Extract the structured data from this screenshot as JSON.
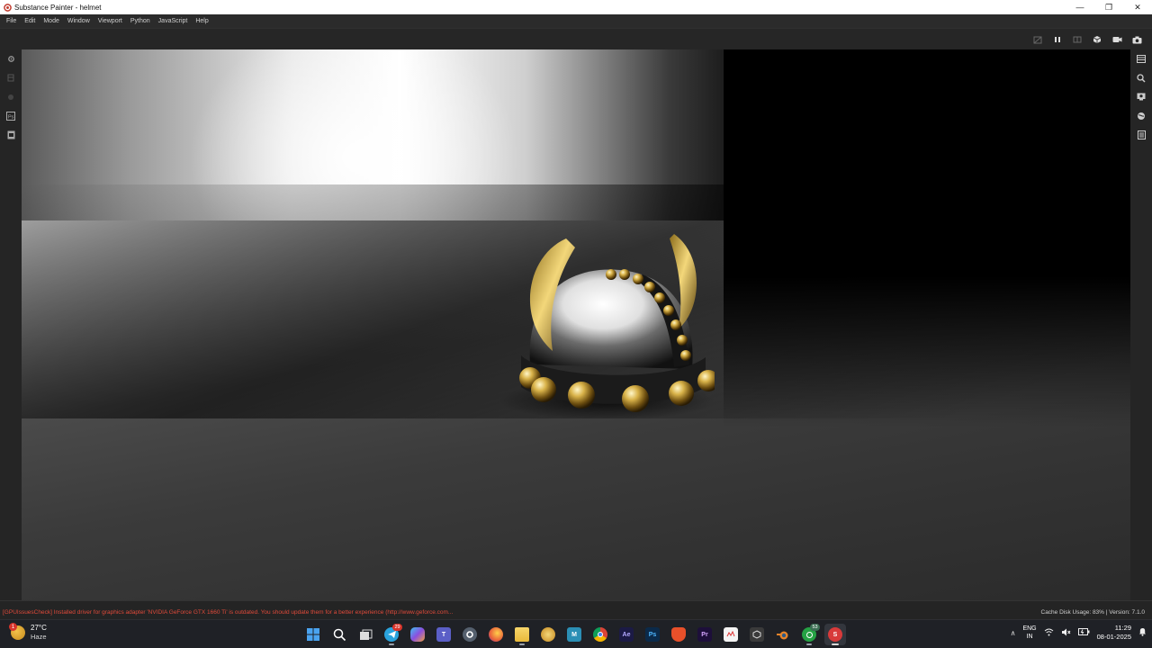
{
  "window": {
    "title": "Substance Painter - helmet",
    "controls": [
      "minimize-icon",
      "restore-icon",
      "close-icon"
    ]
  },
  "menu": [
    "File",
    "Edit",
    "Mode",
    "Window",
    "Viewport",
    "Python",
    "JavaScript",
    "Help"
  ],
  "toolbar": {
    "right_icons": [
      "camera-off-icon",
      "pause-icon",
      "split-view-icon",
      "cube-view-icon",
      "camera-icon",
      "screenshot-icon"
    ]
  },
  "left_tools": [
    "settings-icon",
    "layers-icon",
    "bake-icon",
    "photoshop-export-icon",
    "export-textures-icon"
  ],
  "right_tools": [
    "layers-panel-icon",
    "zoom-icon",
    "display-settings-icon",
    "environment-icon",
    "shader-settings-icon"
  ],
  "status": {
    "warning": "[GPUIssuesCheck] Installed driver for graphics adapter 'NVIDIA GeForce GTX 1660 Ti' is outdated. You should update them for a better experience (http://www.geforce.com...",
    "cache": "Cache Disk Usage:    83% | Version: 7.1.0"
  },
  "taskbar": {
    "weather": {
      "temp": "27°C",
      "condition": "Haze",
      "badge": "1"
    },
    "apps": [
      {
        "name": "start-icon",
        "label": "",
        "color": "#3a8ee6"
      },
      {
        "name": "search-icon",
        "label": "",
        "color": ""
      },
      {
        "name": "task-view-icon",
        "label": "",
        "color": ""
      },
      {
        "name": "telegram-icon",
        "label": "",
        "color": "#2aa3dd",
        "badge": "29"
      },
      {
        "name": "copilot-icon",
        "label": "",
        "color": "#6a5bd6"
      },
      {
        "name": "teams-icon",
        "label": "",
        "color": "#5b5fc7"
      },
      {
        "name": "settings-icon",
        "label": "",
        "color": "#6c7a89"
      },
      {
        "name": "firefox-icon",
        "label": "",
        "color": "#e8613a"
      },
      {
        "name": "file-explorer-icon",
        "label": "",
        "color": "#f2c94c"
      },
      {
        "name": "blender-alt-icon",
        "label": "",
        "color": "#e0a43a"
      },
      {
        "name": "maya-icon",
        "label": "M",
        "color": "#2b8fb5"
      },
      {
        "name": "chrome-icon",
        "label": "",
        "color": "#3c9b4a"
      },
      {
        "name": "after-effects-icon",
        "label": "Ae",
        "color": "#1b1a45"
      },
      {
        "name": "photoshop-icon",
        "label": "Ps",
        "color": "#0b2a4a"
      },
      {
        "name": "brave-icon",
        "label": "",
        "color": "#e8502a"
      },
      {
        "name": "premiere-icon",
        "label": "Pr",
        "color": "#1d0f3a"
      },
      {
        "name": "notepad-icon",
        "label": "",
        "color": "#f4f4f4"
      },
      {
        "name": "unity-icon",
        "label": "",
        "color": "#3a3a3a"
      },
      {
        "name": "blender-icon",
        "label": "",
        "color": "#e8852a"
      },
      {
        "name": "whatsapp-icon",
        "label": "",
        "color": "#25a244",
        "badge": "53"
      },
      {
        "name": "substance-painter-icon",
        "label": "S",
        "color": "#d83a3a"
      }
    ],
    "tray": {
      "lang": "ENG",
      "region": "IN",
      "time": "11:29",
      "date": "08-01-2025"
    }
  }
}
